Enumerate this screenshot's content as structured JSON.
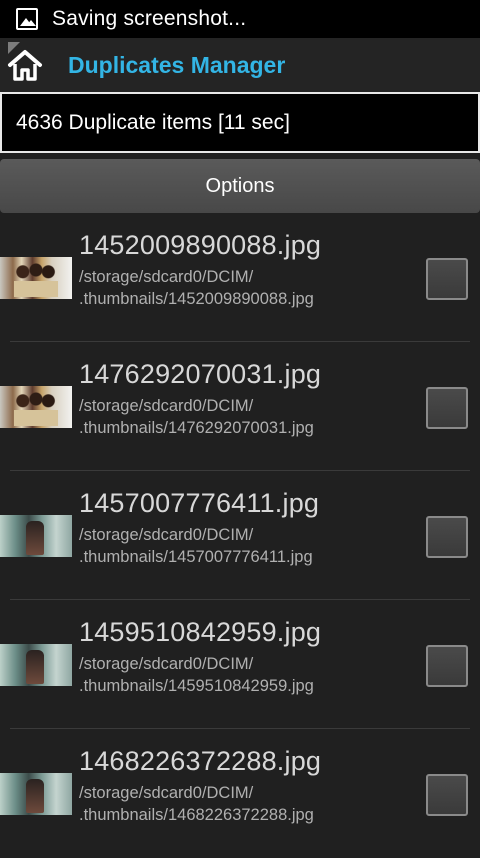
{
  "statusbar": {
    "text": "Saving screenshot...",
    "icon": "image-icon"
  },
  "actionbar": {
    "title": "Duplicates Manager",
    "title_color": "#33b5e5",
    "home_icon": "home-icon"
  },
  "search": {
    "value": "4636 Duplicate items [11 sec]"
  },
  "options": {
    "label": "Options"
  },
  "items": [
    {
      "name": "1452009890088.jpg",
      "path_line1": "/storage/sdcard0/DCIM/",
      "path_line2": ".thumbnails/1452009890088.jpg",
      "thumb": "people",
      "checked": false
    },
    {
      "name": "1476292070031.jpg",
      "path_line1": "/storage/sdcard0/DCIM/",
      "path_line2": ".thumbnails/1476292070031.jpg",
      "thumb": "people",
      "checked": false
    },
    {
      "name": "1457007776411.jpg",
      "path_line1": "/storage/sdcard0/DCIM/",
      "path_line2": ".thumbnails/1457007776411.jpg",
      "thumb": "room",
      "checked": false
    },
    {
      "name": "1459510842959.jpg",
      "path_line1": "/storage/sdcard0/DCIM/",
      "path_line2": ".thumbnails/1459510842959.jpg",
      "thumb": "room",
      "checked": false
    },
    {
      "name": "1468226372288.jpg",
      "path_line1": "/storage/sdcard0/DCIM/",
      "path_line2": ".thumbnails/1468226372288.jpg",
      "thumb": "room",
      "checked": false
    }
  ]
}
